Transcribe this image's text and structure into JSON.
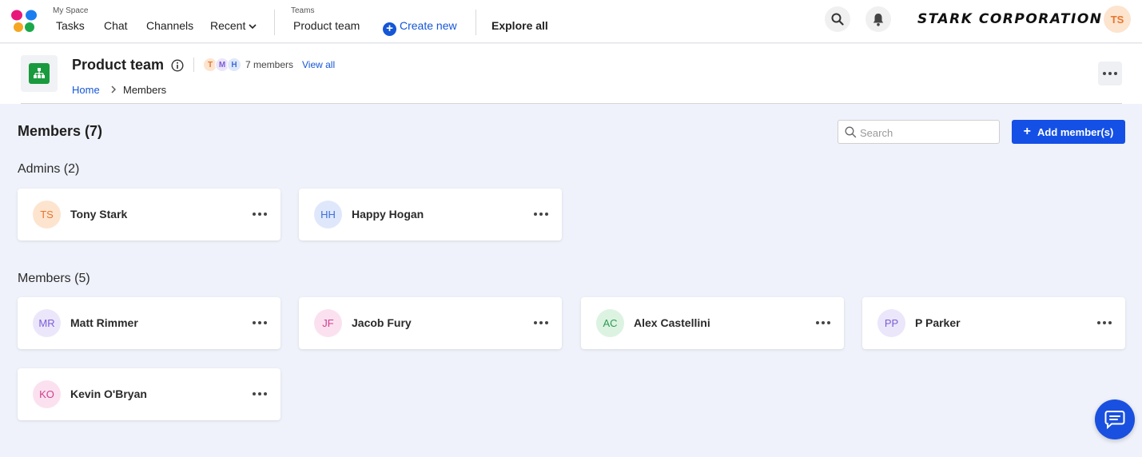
{
  "nav": {
    "my_space_label": "My Space",
    "tasks": "Tasks",
    "chat": "Chat",
    "channels": "Channels",
    "recent": "Recent",
    "teams_label": "Teams",
    "product_team": "Product team",
    "create_new": "Create new",
    "explore_all": "Explore all",
    "brand": "STARK CORPORATION",
    "user_initials": "TS"
  },
  "team": {
    "title": "Product team",
    "mini_avatars": [
      {
        "initial": "T",
        "bg": "#fde4cf",
        "fg": "#e6772e"
      },
      {
        "initial": "M",
        "bg": "#ece6fb",
        "fg": "#7a5ed6"
      },
      {
        "initial": "H",
        "bg": "#dfe8fb",
        "fg": "#3f6fd8"
      }
    ],
    "member_count": "7 members",
    "view_all": "View all",
    "breadcrumb_home": "Home",
    "breadcrumb_current": "Members"
  },
  "main": {
    "title": "Members (7)",
    "search_placeholder": "Search",
    "add_button": "Add member(s)",
    "admins_title": "Admins (2)",
    "members_title": "Members (5)",
    "admins": [
      {
        "initials": "TS",
        "name": "Tony Stark",
        "bg": "#fde4cf",
        "fg": "#e6772e"
      },
      {
        "initials": "HH",
        "name": "Happy Hogan",
        "bg": "#dfe8fb",
        "fg": "#3f6fd8"
      }
    ],
    "members": [
      {
        "initials": "MR",
        "name": "Matt Rimmer",
        "bg": "#ece6fb",
        "fg": "#7a5ed6"
      },
      {
        "initials": "JF",
        "name": "Jacob Fury",
        "bg": "#fbe1ef",
        "fg": "#cf3f8f"
      },
      {
        "initials": "AC",
        "name": "Alex Castellini",
        "bg": "#dcf3e2",
        "fg": "#2f9a4f"
      },
      {
        "initials": "PP",
        "name": "P Parker",
        "bg": "#ece6fb",
        "fg": "#7a5ed6"
      },
      {
        "initials": "KO",
        "name": "Kevin O'Bryan",
        "bg": "#fbe1ef",
        "fg": "#cf3f8f"
      }
    ]
  },
  "colors": {
    "accent": "#1450e6",
    "link": "#1456d6",
    "page_bg": "#eff2fa"
  }
}
